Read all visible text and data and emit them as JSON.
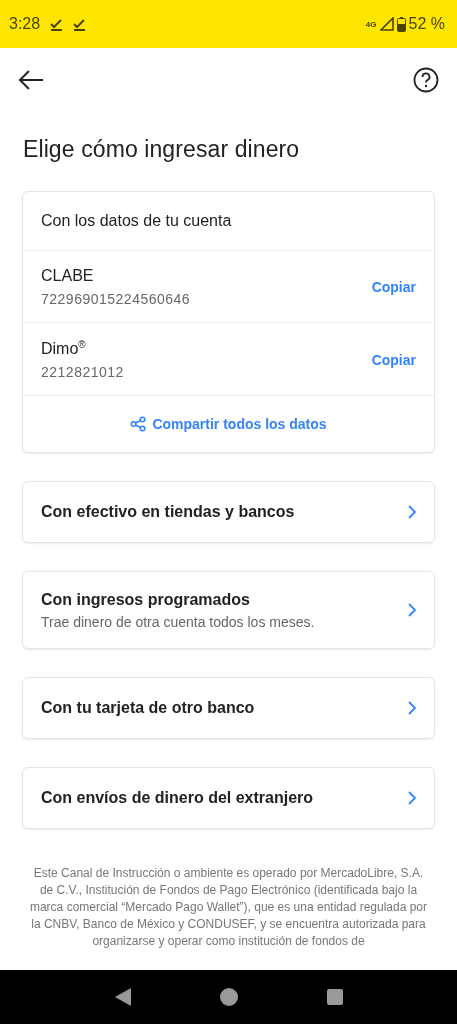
{
  "status_bar": {
    "time": "3:28",
    "network": "4G",
    "battery": "52 %"
  },
  "header": {
    "title": "Elige cómo ingresar dinero"
  },
  "account_card": {
    "title": "Con los datos de tu cuenta",
    "rows": [
      {
        "label": "CLABE",
        "value": "722969015224560646",
        "action": "Copiar"
      },
      {
        "label": "Dimo$^{®}$",
        "value": "2212821012",
        "action": "Copiar"
      }
    ],
    "share": "Compartir todos los datos"
  },
  "options": [
    {
      "title": "Con efectivo en tiendas y bancos"
    },
    {
      "title": "Con ingresos programados",
      "subtitle": "Trae dinero de otra cuenta todos los meses."
    },
    {
      "title": "Con tu tarjeta de otro banco"
    },
    {
      "title": "Con envíos de dinero del extranjero"
    }
  ],
  "legal": "Este Canal de Instrucción o ambiente es operado por MercadoLibre, S.A. de C.V., Institución de Fondos de Pago Electrónico (identificada bajo la marca comercial “Mercado Pago Wallet”), que es una entidad regulada por la CNBV, Banco de México y CONDUSEF, y se encuentra autorizada para organizarse y operar como institución de fondos de"
}
